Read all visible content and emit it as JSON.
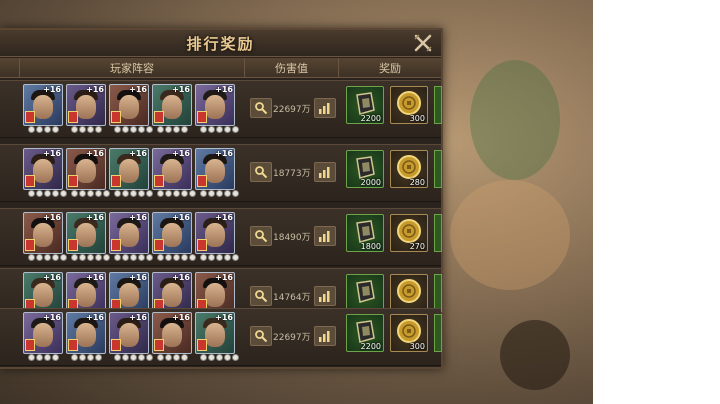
{
  "dialog": {
    "title": "排行奖励",
    "columns": {
      "lineup": "玩家阵容",
      "damage": "伤害值",
      "reward": "奖励"
    }
  },
  "rows": [
    {
      "damage": "22697万",
      "heroes": [
        "+16",
        "+16",
        "+16",
        "+16",
        "+16"
      ],
      "dots": [
        4,
        4,
        5,
        4,
        5
      ],
      "rewards": [
        {
          "type": "jade-token",
          "amount": "2200"
        },
        {
          "type": "gold-coin",
          "amount": "300"
        }
      ]
    },
    {
      "damage": "18773万",
      "heroes": [
        "+16",
        "+16",
        "+16",
        "+16",
        "+16"
      ],
      "dots": [
        5,
        5,
        5,
        5,
        5
      ],
      "rewards": [
        {
          "type": "jade-token",
          "amount": "2000"
        },
        {
          "type": "gold-coin",
          "amount": "280"
        }
      ]
    },
    {
      "damage": "18490万",
      "heroes": [
        "+16",
        "+16",
        "+16",
        "+16",
        "+16"
      ],
      "dots": [
        5,
        5,
        5,
        5,
        5
      ],
      "rewards": [
        {
          "type": "jade-token",
          "amount": "1800"
        },
        {
          "type": "gold-coin",
          "amount": "270"
        }
      ]
    },
    {
      "damage": "14764万",
      "heroes": [
        "+16",
        "+16",
        "+16",
        "+16",
        "+16"
      ],
      "dots": [
        5,
        5,
        5,
        5,
        5
      ],
      "rewards": [
        {
          "type": "jade-token",
          "amount": ""
        },
        {
          "type": "gold-coin",
          "amount": ""
        }
      ]
    },
    {
      "damage": "22697万",
      "heroes": [
        "+16",
        "+16",
        "+16",
        "+16",
        "+16"
      ],
      "dots": [
        4,
        4,
        5,
        4,
        5
      ],
      "rewards": [
        {
          "type": "jade-token",
          "amount": "2200"
        },
        {
          "type": "gold-coin",
          "amount": "300"
        }
      ]
    }
  ],
  "icons": {
    "close": "close-icon",
    "search": "magnifier-icon",
    "rank": "bar-chart-icon",
    "jade": "jade-token-icon",
    "coin": "gold-coin-icon"
  },
  "colors": {
    "title": "#e9c991",
    "panel": "#2b241e",
    "reward_green": "#6fa34a"
  }
}
